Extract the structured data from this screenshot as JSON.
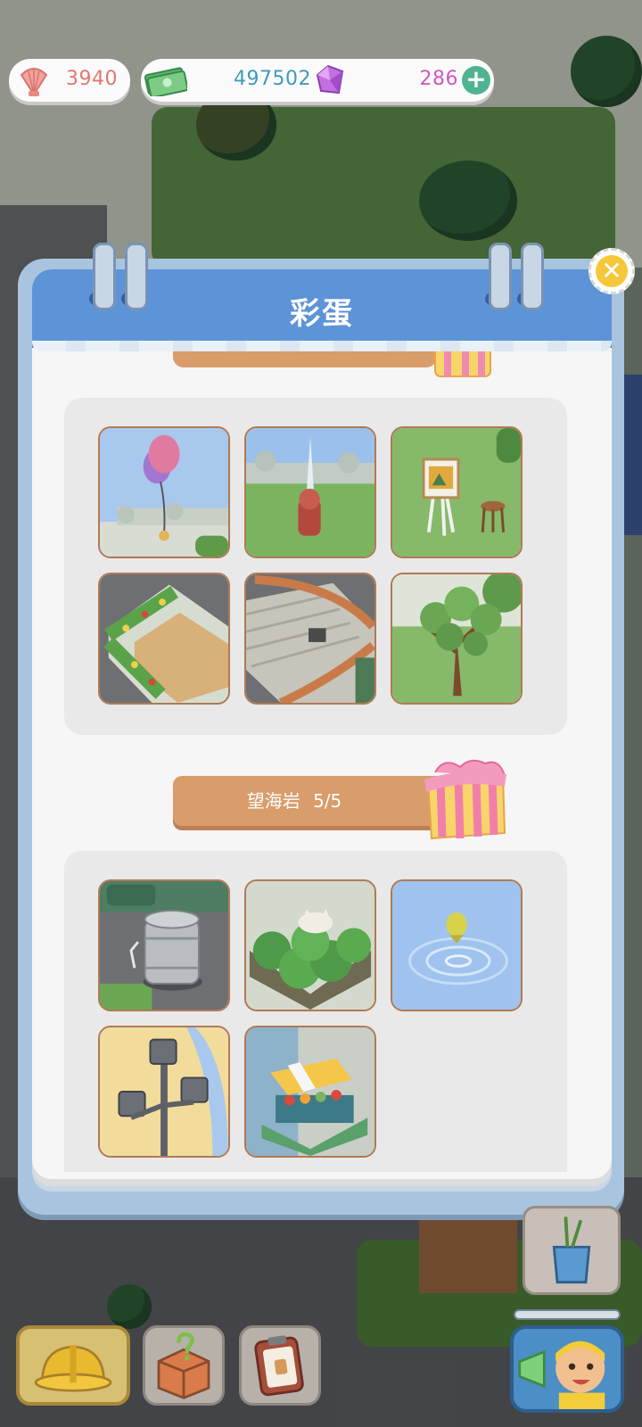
{
  "currency": {
    "shells": "3940",
    "cash": "497502",
    "gems": "286",
    "add_label": "+"
  },
  "modal": {
    "title": "彩蛋",
    "close_label": "✕",
    "sections": [
      {
        "items": [
          "balloon",
          "fire-hydrant-fountain",
          "easel-and-stool",
          "flower-bed-deck",
          "tiled-roof",
          "tree"
        ]
      },
      {
        "name": "望海岩",
        "progress": "5/5",
        "items": [
          "beer-keg",
          "cat-in-bushes",
          "fish-in-water",
          "street-lamp",
          "fruit-stall"
        ]
      }
    ]
  },
  "bottom_bar": {
    "buttons": [
      "helmet-icon",
      "question-box-icon",
      "clipboard-icon"
    ]
  },
  "colors": {
    "header_blue": "#5d93d7",
    "label_orange": "#d99c6b",
    "shell_text": "#e3766f",
    "cash_text": "#3e9bb6",
    "gem_text": "#d257c3",
    "close_yellow": "#f5c83a"
  }
}
